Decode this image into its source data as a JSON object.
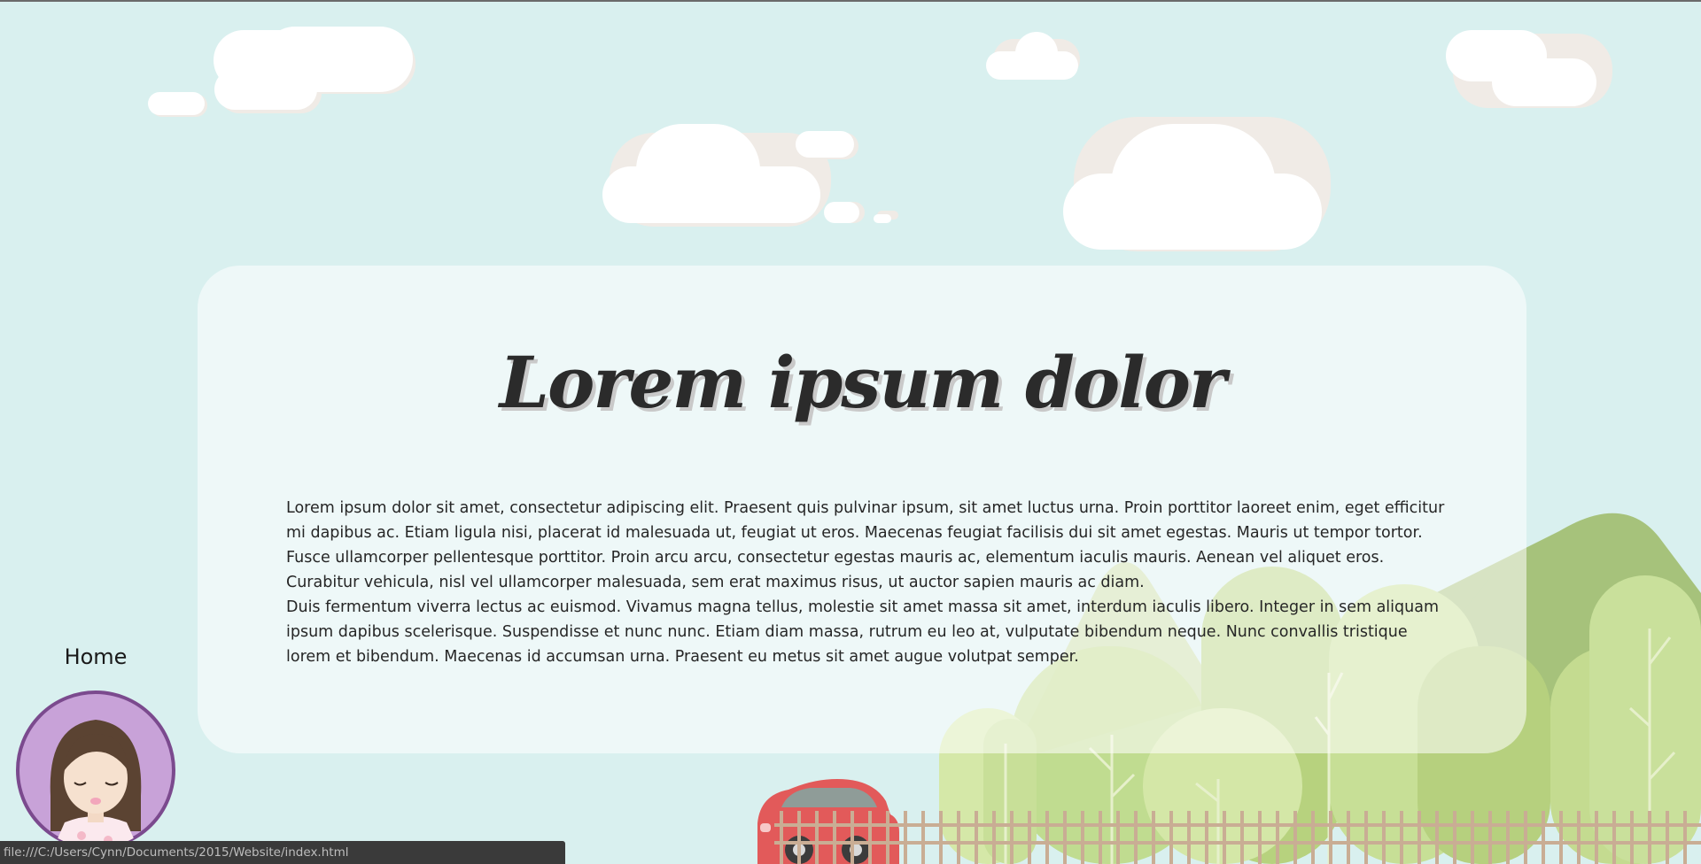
{
  "page": {
    "title": "Lorem ipsum dolor",
    "paragraphs": [
      "Lorem ipsum dolor sit amet, consectetur adipiscing elit. Praesent quis pulvinar ipsum, sit amet luctus urna. Proin porttitor laoreet enim, eget efficitur mi dapibus ac. Etiam ligula nisi, placerat id malesuada ut, feugiat ut eros. Maecenas feugiat facilisis dui sit amet egestas. Mauris ut tempor tortor. Fusce ullamcorper pellentesque porttitor. Proin arcu arcu, consectetur egestas mauris ac, elementum iaculis mauris. Aenean vel aliquet eros. Curabitur vehicula, nisl vel ullamcorper malesuada, sem erat maximus risus, ut auctor sapien mauris ac diam.",
      "Duis fermentum viverra lectus ac euismod. Vivamus magna tellus, molestie sit amet massa sit amet, interdum iaculis libero. Integer in sem aliquam ipsum dapibus scelerisque. Suspendisse et nunc nunc. Etiam diam massa, rutrum eu leo at, vulputate bibendum neque. Nunc convallis tristique lorem et bibendum. Maecenas id accumsan urna. Praesent eu metus sit amet augue volutpat semper."
    ]
  },
  "nav": {
    "home_label": "Home",
    "avatar_icon": "girl-avatar-icon"
  },
  "status_bar": {
    "url": "file:///C:/Users/Cynn/Documents/2015/Website/index.html"
  },
  "decor": {
    "icons": [
      "cloud-icon",
      "mountain-icon",
      "tree-icon",
      "car-icon",
      "fence-icon"
    ]
  },
  "colors": {
    "sky": "#d9f0ef",
    "cloud": "#ffffff",
    "cloud_shadow": "#f0ebe6",
    "mountain": "#a6c27b",
    "tree_light": "#cfe49a",
    "tree_mid": "#bcd985",
    "car": "#e25a5a",
    "fence": "#c9ad94",
    "avatar_bg": "#c8a2d8",
    "avatar_ring": "#7b4a8e",
    "hair": "#5b4332",
    "status_bg": "#3a3a3a"
  }
}
